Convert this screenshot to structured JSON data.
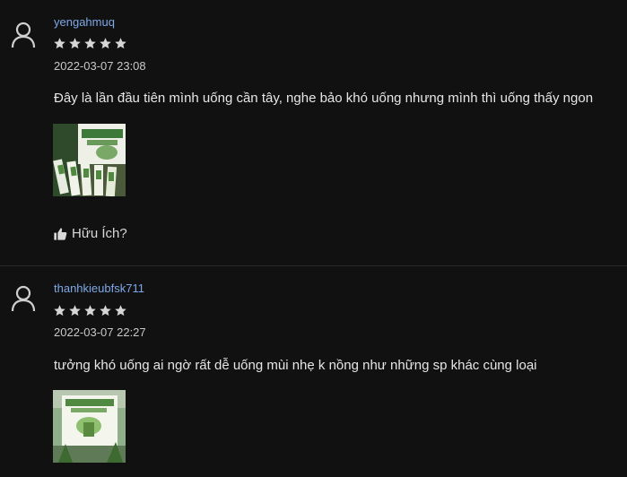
{
  "reviews": [
    {
      "username": "yengahmuq",
      "rating": 5,
      "max_rating": 5,
      "timestamp": "2022-03-07 23:08",
      "comment": "Đây là lần đầu tiên mình uống cần tây, nghe bảo khó uống nhưng mình thì uống thấy ngon",
      "helpful_label": "Hữu Ích?"
    },
    {
      "username": "thanhkieubfsk711",
      "rating": 5,
      "max_rating": 5,
      "timestamp": "2022-03-07 22:27",
      "comment": "tưởng khó uống ai ngờ rất dễ uống mùi nhẹ k nồng như những sp khác cùng loại"
    }
  ],
  "colors": {
    "background": "#111111",
    "username": "#7fa8e8",
    "star": "#d6d6d6",
    "text": "#e6e6e6"
  }
}
